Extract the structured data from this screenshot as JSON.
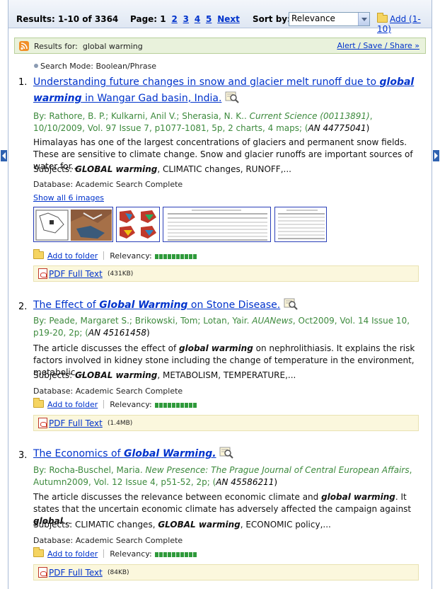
{
  "toolbar": {
    "results_label": "Results: 1-10 of 3364",
    "page_label": "Page: 1",
    "page_links": [
      "2",
      "3",
      "4",
      "5",
      "Next"
    ],
    "sort_label": "Sort by:",
    "sort_value": "Relevance",
    "add_label": "Add (1-10)"
  },
  "results_for": {
    "label": "Results for:",
    "query": "global warming",
    "alert_link": "Alert / Save / Share »"
  },
  "search_mode": "Search Mode: Boolean/Phrase",
  "results": [
    {
      "number": "1.",
      "title_pre": "Understanding future changes in snow and glacier melt runoff due to ",
      "title_em": "global warming",
      "title_post": " in Wangar Gad basin, India.",
      "authors": "By: Rathore, B. P.; Kulkarni, Anil V.; Sherasia, N. K..",
      "source": "Current Science (00113891)",
      "pub": ", 10/10/2009, Vol. 97 Issue 7, p1077-1081, 5p, 2 charts, 4 maps; (",
      "an": "AN 44775041",
      "an_close": ")",
      "abstract": "Himalayas has one of the largest concentrations of glaciers and permanent snow fields. These are sensitive to climate change. Snow and glacier runoffs are important sources of water for...",
      "subjects_label": "Subjects:",
      "subjects_em": "GLOBAL warming",
      "subjects_rest": ", CLIMATIC changes, RUNOFF,...",
      "database": "Database: Academic Search Complete",
      "show_images": "Show all 6 images",
      "add_folder": "Add to folder",
      "relevancy": "Relevancy:",
      "pdf_label": "PDF Full Text",
      "pdf_size": "(431KB)"
    },
    {
      "number": "2.",
      "title_pre": "The Effect of ",
      "title_em": "Global Warming",
      "title_post": " on Stone Disease.",
      "authors": "By: Peade, Margaret S.; Brikowski, Tom; Lotan, Yair.",
      "source": "AUANews",
      "pub": ", Oct2009, Vol. 14 Issue 10, p19-20, 2p; (",
      "an": "AN 45161458",
      "an_close": ")",
      "abstract_pre": "The article discusses the effect of ",
      "abstract_em": "global warming",
      "abstract_post": " on nephrolithiasis. It explains the risk factors involved in kidney stone including the change of temperature in the environment, metabolic...",
      "subjects_label": "Subjects:",
      "subjects_em": "GLOBAL warming",
      "subjects_rest": ", METABOLISM, TEMPERATURE,...",
      "database": "Database: Academic Search Complete",
      "add_folder": "Add to folder",
      "relevancy": "Relevancy:",
      "pdf_label": "PDF Full Text",
      "pdf_size": "(1.4MB)"
    },
    {
      "number": "3.",
      "title_pre": "The Economics of ",
      "title_em": "Global Warming.",
      "title_post": "",
      "authors": "By: Rocha-Buschel, Maria.",
      "source": "New Presence: The Prague Journal of Central European Affairs",
      "pub": ", Autumn2009, Vol. 12 Issue 4, p51-52, 2p; (",
      "an": "AN 45586211",
      "an_close": ")",
      "abstract_pre": "The article discusses the relevance between economic climate and ",
      "abstract_em": "global warming",
      "abstract_mid": ". It states that the uncertain economic climate has adversely affected the campaign against ",
      "abstract_em2": "global",
      "abstract_post": "...",
      "subjects_label": "Subjects:",
      "subjects_pre": "CLIMATIC changes, ",
      "subjects_em": "GLOBAL warming",
      "subjects_rest": ", ECONOMIC policy,...",
      "database": "Database: Academic Search Complete",
      "add_folder": "Add to folder",
      "relevancy": "Relevancy:",
      "pdf_label": "PDF Full Text",
      "pdf_size": "(84KB)"
    }
  ],
  "relevancy_level": 1.0
}
